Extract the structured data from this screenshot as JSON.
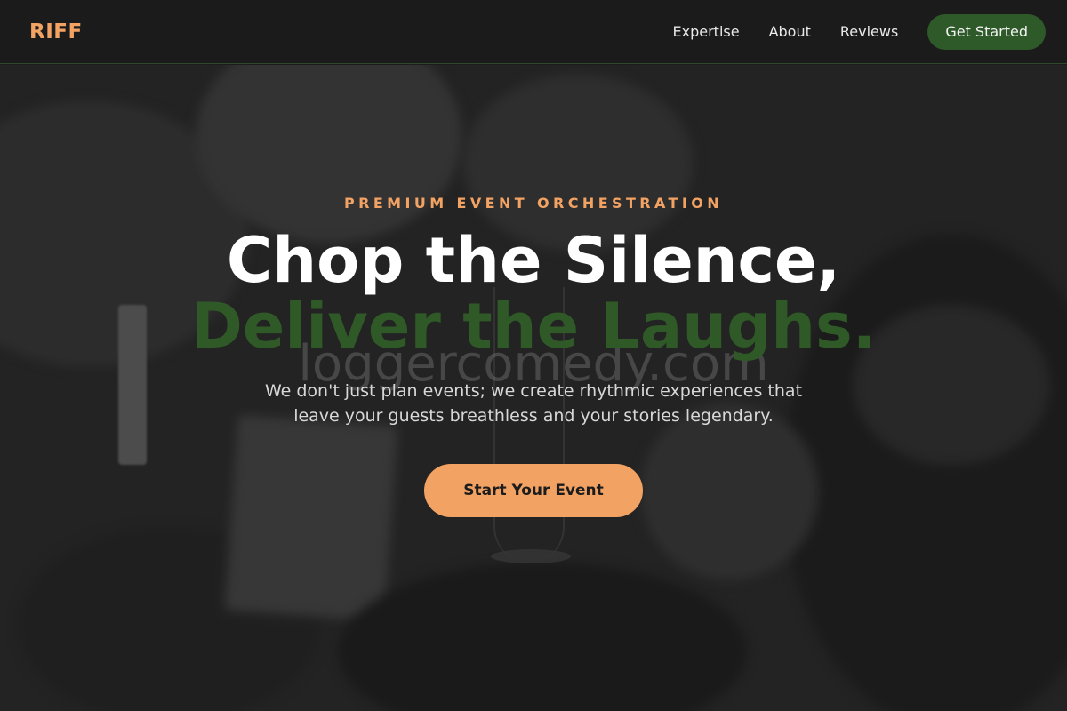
{
  "brand": {
    "name": "RIFF"
  },
  "nav": {
    "links": [
      {
        "label": "Expertise"
      },
      {
        "label": "About"
      },
      {
        "label": "Reviews"
      }
    ],
    "cta_label": "Get Started"
  },
  "hero": {
    "eyebrow": "PREMIUM EVENT ORCHESTRATION",
    "headline_line1": "Chop the Silence,",
    "headline_line2": "Deliver the Laughs.",
    "watermark": "loggercomedy.com",
    "subtitle": "We don't just plan events; we create rhythmic experiences that leave your guests breathless and your stories legendary.",
    "cta_label": "Start Your Event"
  },
  "colors": {
    "accent_orange": "#f2a263",
    "accent_green": "#2e5a2a",
    "background": "#1b1b1b"
  }
}
